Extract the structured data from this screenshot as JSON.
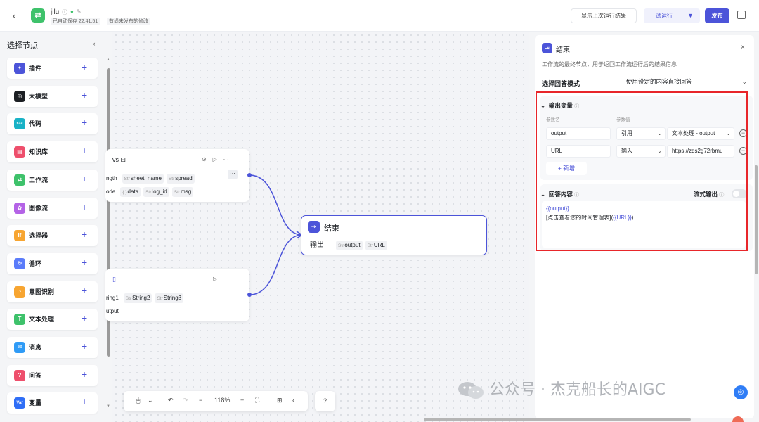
{
  "topbar": {
    "app_name": "jilu",
    "autosave": "已自动保存 22:41:51",
    "publish_status": "有尚未发布的修改",
    "show_last_run": "显示上次运行结果",
    "test_run": "试运行",
    "publish": "发布"
  },
  "sidebar": {
    "title": "选择节点",
    "items": [
      {
        "label": "插件",
        "icon": "plugin-icon",
        "color": "#4c54d9",
        "glyph": "✦"
      },
      {
        "label": "大模型",
        "icon": "llm-icon",
        "color": "#1c1f23",
        "glyph": "◎"
      },
      {
        "label": "代码",
        "icon": "code-icon",
        "color": "#19b2c6",
        "glyph": "</>"
      },
      {
        "label": "知识库",
        "icon": "knowledge-icon",
        "color": "#ee4f6c",
        "glyph": "▤"
      },
      {
        "label": "工作流",
        "icon": "workflow-icon",
        "color": "#3ec26b",
        "glyph": "⇄"
      },
      {
        "label": "图像流",
        "icon": "imageflow-icon",
        "color": "#b463e6",
        "glyph": "✿"
      },
      {
        "label": "选择器",
        "icon": "selector-icon",
        "color": "#f7a531",
        "glyph": "If"
      },
      {
        "label": "循环",
        "icon": "loop-icon",
        "color": "#5b7cfa",
        "glyph": "↻"
      },
      {
        "label": "意图识别",
        "icon": "intent-icon",
        "color": "#f7a531",
        "glyph": "◔"
      },
      {
        "label": "文本处理",
        "icon": "text-process-icon",
        "color": "#3ec26b",
        "glyph": "T"
      },
      {
        "label": "消息",
        "icon": "message-icon",
        "color": "#2f9bf6",
        "glyph": "✉"
      },
      {
        "label": "问答",
        "icon": "qa-icon",
        "color": "#ee4f6c",
        "glyph": "?"
      },
      {
        "label": "变量",
        "icon": "variable-icon",
        "color": "#2f6ef6",
        "glyph": "Var"
      }
    ]
  },
  "canvas": {
    "node1": {
      "title": "vs",
      "row1": [
        {
          "type": "",
          "name": "ngth"
        },
        {
          "type": "Str",
          "name": "sheet_name"
        },
        {
          "type": "Str",
          "name": "spread"
        }
      ],
      "row2": [
        {
          "type": "",
          "name": "ode"
        },
        {
          "type": "{ }",
          "name": "data"
        },
        {
          "type": "Str",
          "name": "log_id"
        },
        {
          "type": "Str",
          "name": "msg"
        }
      ]
    },
    "node2": {
      "row1": [
        {
          "type": "",
          "name": "ring1"
        },
        {
          "type": "Str",
          "name": "String2"
        },
        {
          "type": "Str",
          "name": "String3"
        }
      ],
      "row2": [
        {
          "type": "",
          "name": "utput"
        }
      ]
    },
    "end_node": {
      "title": "结束",
      "output_label": "输出",
      "outputs": [
        {
          "type": "Str",
          "name": "output"
        },
        {
          "type": "Str",
          "name": "URL"
        }
      ]
    }
  },
  "toolbar": {
    "zoom": "118%"
  },
  "panel": {
    "title": "结束",
    "description": "工作流的最终节点，用于返回工作流运行后的结果信息",
    "mode_label": "选择回答模式",
    "mode_value": "使用设定的内容直接回答",
    "output_vars": {
      "title": "输出变量",
      "col_name": "参数名",
      "col_value": "参数值",
      "rows": [
        {
          "name": "output",
          "source": "引用",
          "value": "文本处理 - output"
        },
        {
          "name": "URL",
          "source": "输入",
          "value": "https://zqs2g72rbmu"
        }
      ],
      "add": "新增"
    },
    "answer": {
      "title": "回答内容",
      "stream_label": "流式输出",
      "line1": "{{output}}",
      "line2_prefix": "[点击查看您的时间管理表](",
      "line2_var": "{{URL}}",
      "line2_suffix": ")"
    }
  },
  "watermark": "公众号 · 杰克船长的AIGC"
}
